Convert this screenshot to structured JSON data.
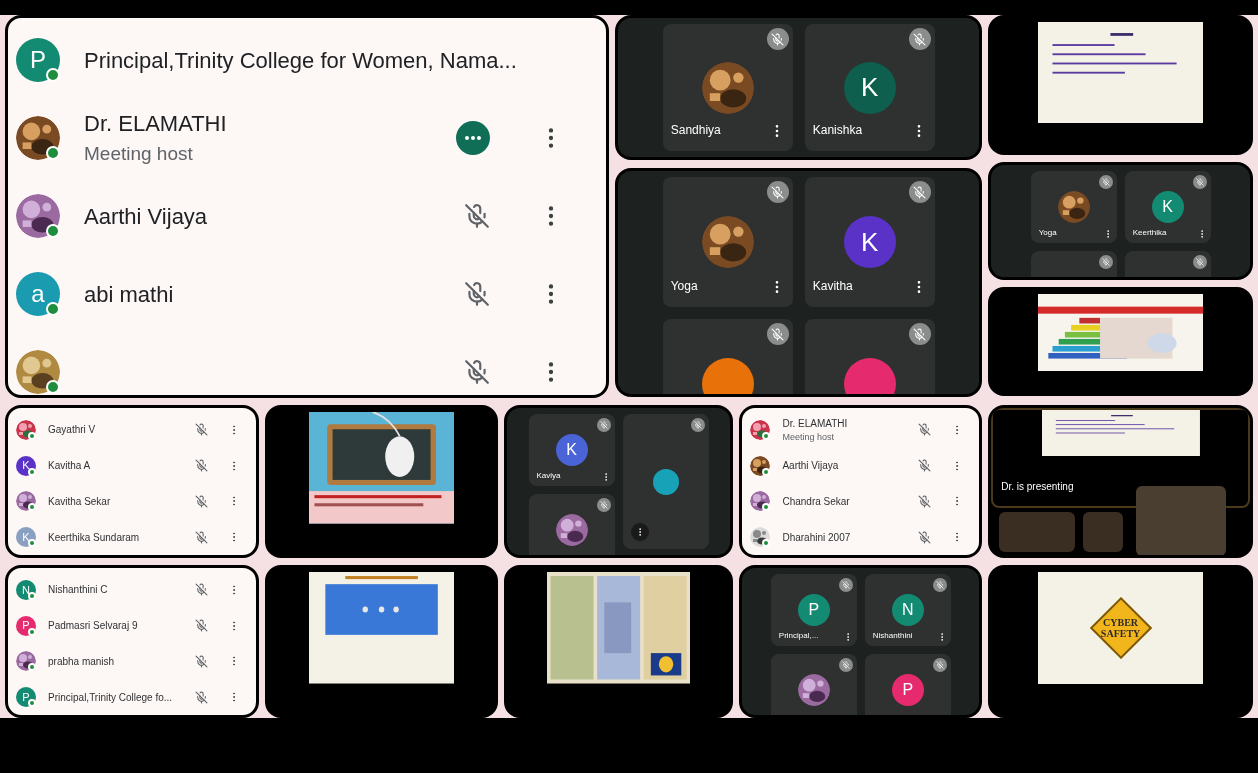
{
  "top": {
    "list": {
      "participants": [
        {
          "name": "Principal,Trinity College for Women, Nama...",
          "avatar": {
            "kind": "letter",
            "letter": "P",
            "color": "#138a72"
          },
          "speaking": false,
          "muted": false,
          "menu": false
        },
        {
          "name": "Dr. ELAMATHI",
          "role": "Meeting host",
          "speaking": true,
          "muted": false,
          "menu": true
        },
        {
          "name": "Aarthi Vijaya",
          "speaking": false,
          "muted": true,
          "menu": true
        },
        {
          "name": "abi mathi",
          "avatar": {
            "kind": "letter",
            "letter": "a",
            "color": "#1a9bb0"
          },
          "speaking": false,
          "muted": true,
          "menu": true
        },
        {
          "speaking": false,
          "muted": true,
          "menu": true
        }
      ]
    },
    "middle": [
      {
        "kind": "grid",
        "columns": [
          [
            {
              "name": "Sandhiya",
              "menu": true
            }
          ],
          [
            {
              "name": "Kanishka",
              "avatar": {
                "kind": "letter",
                "letter": "K",
                "color": "#0e5f4e"
              },
              "menu": true
            }
          ]
        ]
      },
      {
        "kind": "grid",
        "columns": [
          [
            {
              "name": "Yoga",
              "menu": true
            },
            {
              "avatar": {
                "kind": "letter",
                "color": "#e8710a"
              },
              "menu": false
            }
          ],
          [
            {
              "name": "Kavitha",
              "avatar": {
                "kind": "letter",
                "letter": "K",
                "color": "#5a32c8"
              },
              "menu": true
            },
            {
              "avatar": {
                "kind": "letter",
                "color": "#e52b6e"
              },
              "menu": false
            }
          ]
        ]
      }
    ],
    "right": [
      {
        "kind": "slide",
        "slide": {
          "kind": "text"
        }
      },
      {
        "kind": "grid",
        "columns": [
          [
            {
              "name": "Yoga",
              "menu": true
            },
            {
              "menu": false
            }
          ],
          [
            {
              "name": "Keerthika",
              "avatar": {
                "kind": "letter",
                "letter": "K",
                "color": "#138a72"
              },
              "menu": true
            },
            {
              "menu": false
            }
          ]
        ]
      },
      {
        "kind": "slide",
        "slide": {
          "kind": "hierarchy"
        }
      }
    ]
  },
  "bottom_rows": [
    [
      {
        "kind": "list",
        "participants": [
          {
            "name": "Gayathri V",
            "speaking": false,
            "muted": true,
            "menu": true
          },
          {
            "name": "Kavitha A",
            "avatar": {
              "kind": "letter",
              "letter": "K",
              "color": "#5a32c8"
            },
            "speaking": false,
            "muted": true,
            "menu": true
          },
          {
            "name": "Kavitha Sekar",
            "speaking": false,
            "muted": true,
            "menu": true
          },
          {
            "name": "Keerthika Sundaram",
            "avatar": {
              "kind": "letter",
              "letter": "K",
              "color": "#8aa0c0"
            },
            "speaking": false,
            "muted": true,
            "menu": true
          }
        ]
      },
      {
        "kind": "slide"
      },
      {
        "kind": "grid",
        "columns": [
          [
            {
              "name": "Kaviya",
              "avatar": {
                "kind": "letter",
                "letter": "K",
                "color": "#4a64d8"
              },
              "menu": true
            },
            {
              "menu": false
            }
          ],
          [
            {
              "avatar": {
                "kind": "dot",
                "color": "#17a2b8"
              },
              "menu": true
            }
          ]
        ]
      },
      {
        "kind": "list",
        "participants": [
          {
            "name": "Dr. ELAMATHI",
            "role": "Meeting host",
            "speaking": false,
            "muted": true,
            "menu": true
          },
          {
            "name": "Aarthi Vijaya",
            "speaking": false,
            "muted": true,
            "menu": true
          },
          {
            "name": "Chandra Sekar",
            "speaking": false,
            "muted": true,
            "menu": true
          },
          {
            "name": "Dharahini 2007",
            "speaking": false,
            "muted": true,
            "menu": true
          }
        ]
      },
      {
        "kind": "presenting",
        "caption": "Dr. is presenting",
        "slide": {
          "kind": "text"
        }
      }
    ],
    [
      {
        "kind": "list",
        "participants": [
          {
            "name": "Nishanthini C",
            "avatar": {
              "kind": "letter",
              "letter": "N",
              "color": "#138a72"
            },
            "speaking": false,
            "muted": true,
            "menu": true
          },
          {
            "name": "Padmasri Selvaraj 9",
            "avatar": {
              "kind": "letter",
              "letter": "P",
              "color": "#e52b6e"
            },
            "speaking": false,
            "muted": true,
            "menu": true
          },
          {
            "name": "prabha manish",
            "speaking": false,
            "muted": true,
            "menu": true
          },
          {
            "name": "Principal,Trinity College fo...",
            "avatar": {
              "kind": "letter",
              "letter": "P",
              "color": "#138a72"
            },
            "speaking": false,
            "muted": true,
            "menu": true
          }
        ]
      },
      {
        "kind": "slide",
        "slide": {
          "kind": "quiz"
        }
      },
      {
        "kind": "slide",
        "slide": {
          "kind": "skills"
        }
      },
      {
        "kind": "grid",
        "columns": [
          [
            {
              "name": "Principal,...",
              "avatar": {
                "kind": "letter",
                "letter": "P",
                "color": "#138a72"
              },
              "menu": true
            },
            {
              "menu": false
            }
          ],
          [
            {
              "name": "Nishanthini",
              "avatar": {
                "kind": "letter",
                "letter": "N",
                "color": "#138a72"
              },
              "menu": true
            },
            {
              "avatar": {
                "kind": "letter",
                "letter": "P",
                "color": "#e52b6e"
              },
              "menu": false
            }
          ]
        ]
      },
      {
        "kind": "slide",
        "slide": {
          "kind": "cyber",
          "title": "CYBER SAFETY"
        }
      }
    ]
  ]
}
